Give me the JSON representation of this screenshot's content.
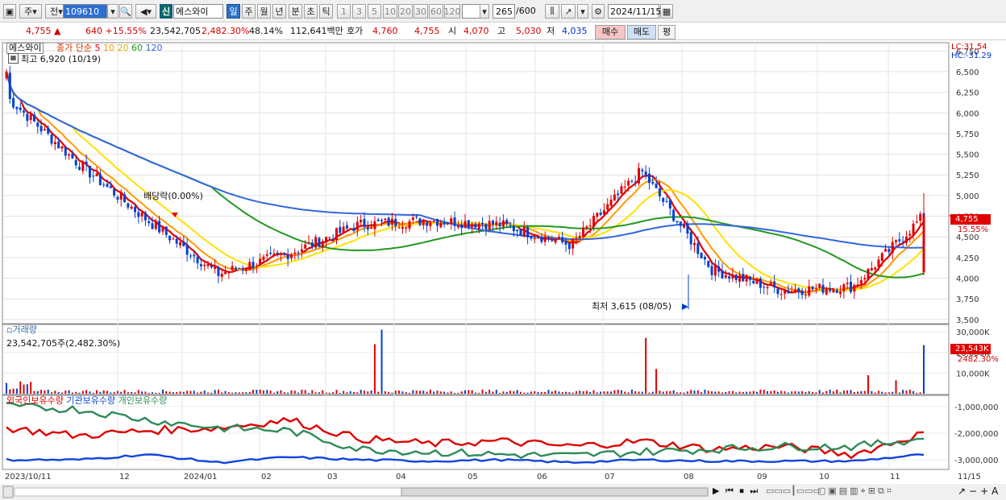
{
  "toolbar": {
    "period_type": "주",
    "compare": "전",
    "code": "109610",
    "new_badge": "신",
    "stock_name": "에스와이",
    "periods": [
      "일",
      "주",
      "월",
      "년",
      "분",
      "초",
      "틱"
    ],
    "selected_period": "일",
    "intervals": [
      "1",
      "3",
      "5",
      "10",
      "20",
      "30",
      "60",
      "120"
    ],
    "count": "265",
    "count_total": "/600",
    "date": "2024/11/15"
  },
  "info": {
    "price": "4,755",
    "change": "640 +15.55%",
    "volume": "23,542,705",
    "volume_ratio": "2,482.30%",
    "turnover": "48.14%",
    "amount": "112,641백만",
    "quote_label": "호가",
    "ask": "4,760",
    "bid": "4,755",
    "open_label": "시",
    "open": "4,070",
    "high_label": "고",
    "high": "5,030",
    "low_label": "저",
    "low": "4,035",
    "buy_label": "매수",
    "sell_label": "매도",
    "eval_label": "평"
  },
  "price_panel": {
    "name_tag": "에스와이",
    "ma_title": "종가 단순",
    "ma_periods": [
      "5",
      "10",
      "20",
      "60",
      "120"
    ],
    "ma_colors": [
      "#e00000",
      "#ff9900",
      "#ffe000",
      "#229922",
      "#3366dd"
    ],
    "high_note": "최고 6,920 (10/19)",
    "low_note": "최저 3,615 (08/05)",
    "dividend_note": "배당락(0.00%)",
    "lc": "LC:31.54",
    "hc": "HC:-31.29",
    "current_price": "4,755",
    "current_change": "15.55%",
    "y_ticks": [
      "6,750",
      "6,500",
      "6,250",
      "6,000",
      "5,750",
      "5,500",
      "5,250",
      "5,000",
      "4,750",
      "4,500",
      "4,250",
      "4,000",
      "3,750",
      "3,500"
    ]
  },
  "volume_panel": {
    "title": "거래량",
    "value": "23,542,705주(2,482.30%)",
    "y_ticks": [
      "30,000K",
      "20,000K",
      "10,000K"
    ],
    "current": "23,543K",
    "current_ratio": "2482.30%"
  },
  "holdings_panel": {
    "labels": [
      "외국인보유수량",
      "기관보유수량",
      "개인보유수량"
    ],
    "colors": [
      "#dd0000",
      "#1144dd",
      "#2e8b57"
    ],
    "y_ticks": [
      "-1,000,000",
      "-2,000,000",
      "-3,000,000"
    ]
  },
  "x_axis": {
    "labels": [
      "2023/10/11",
      "12",
      "2024/01",
      "02",
      "03",
      "04",
      "05",
      "06",
      "07",
      "08",
      "09",
      "10",
      "11",
      "11/15"
    ]
  },
  "chart_data": [
    {
      "type": "candlestick",
      "title": "에스와이",
      "ylim": [
        3450,
        6850
      ],
      "key_points": {
        "start_close": 6500,
        "high": 6920,
        "high_date": "10/19",
        "low": 3615,
        "low_date": "08/05",
        "last_close": 4755
      },
      "monthly_close": [
        6200,
        5400,
        4700,
        4050,
        4300,
        4650,
        4700,
        4650,
        4400,
        5300,
        4100,
        3850,
        3900,
        4755
      ]
    },
    {
      "type": "bar",
      "title": "거래량",
      "ylim": [
        0,
        32000
      ],
      "unit": "K",
      "last_value": 23543,
      "spikes": [
        {
          "label": "03",
          "value": 31000
        },
        {
          "label": "07",
          "value": 27000
        },
        {
          "label": "11/15",
          "value": 23543
        }
      ]
    },
    {
      "type": "line",
      "title": "보유수량",
      "ylim": [
        -3300000,
        -700000
      ],
      "series": [
        {
          "name": "외국인보유수량",
          "values": [
            -1800000,
            -2100000,
            -1900000,
            -1800000,
            -1500000,
            -2200000,
            -2400000,
            -2300000,
            -2500000,
            -2300000,
            -2600000,
            -2500000,
            -2800000,
            -2000000
          ]
        },
        {
          "name": "기관보유수량",
          "values": [
            -3000000,
            -3000000,
            -2800000,
            -3100000,
            -2900000,
            -3000000,
            -3050000,
            -3000000,
            -3100000,
            -3000000,
            -3050000,
            -3050000,
            -3050000,
            -2800000
          ]
        },
        {
          "name": "개인보유수량",
          "values": [
            -1000000,
            -1100000,
            -1500000,
            -1800000,
            -1900000,
            -2600000,
            -2700000,
            -2800000,
            -2850000,
            -2700000,
            -2600000,
            -2500000,
            -2500000,
            -2200000
          ]
        }
      ]
    }
  ]
}
